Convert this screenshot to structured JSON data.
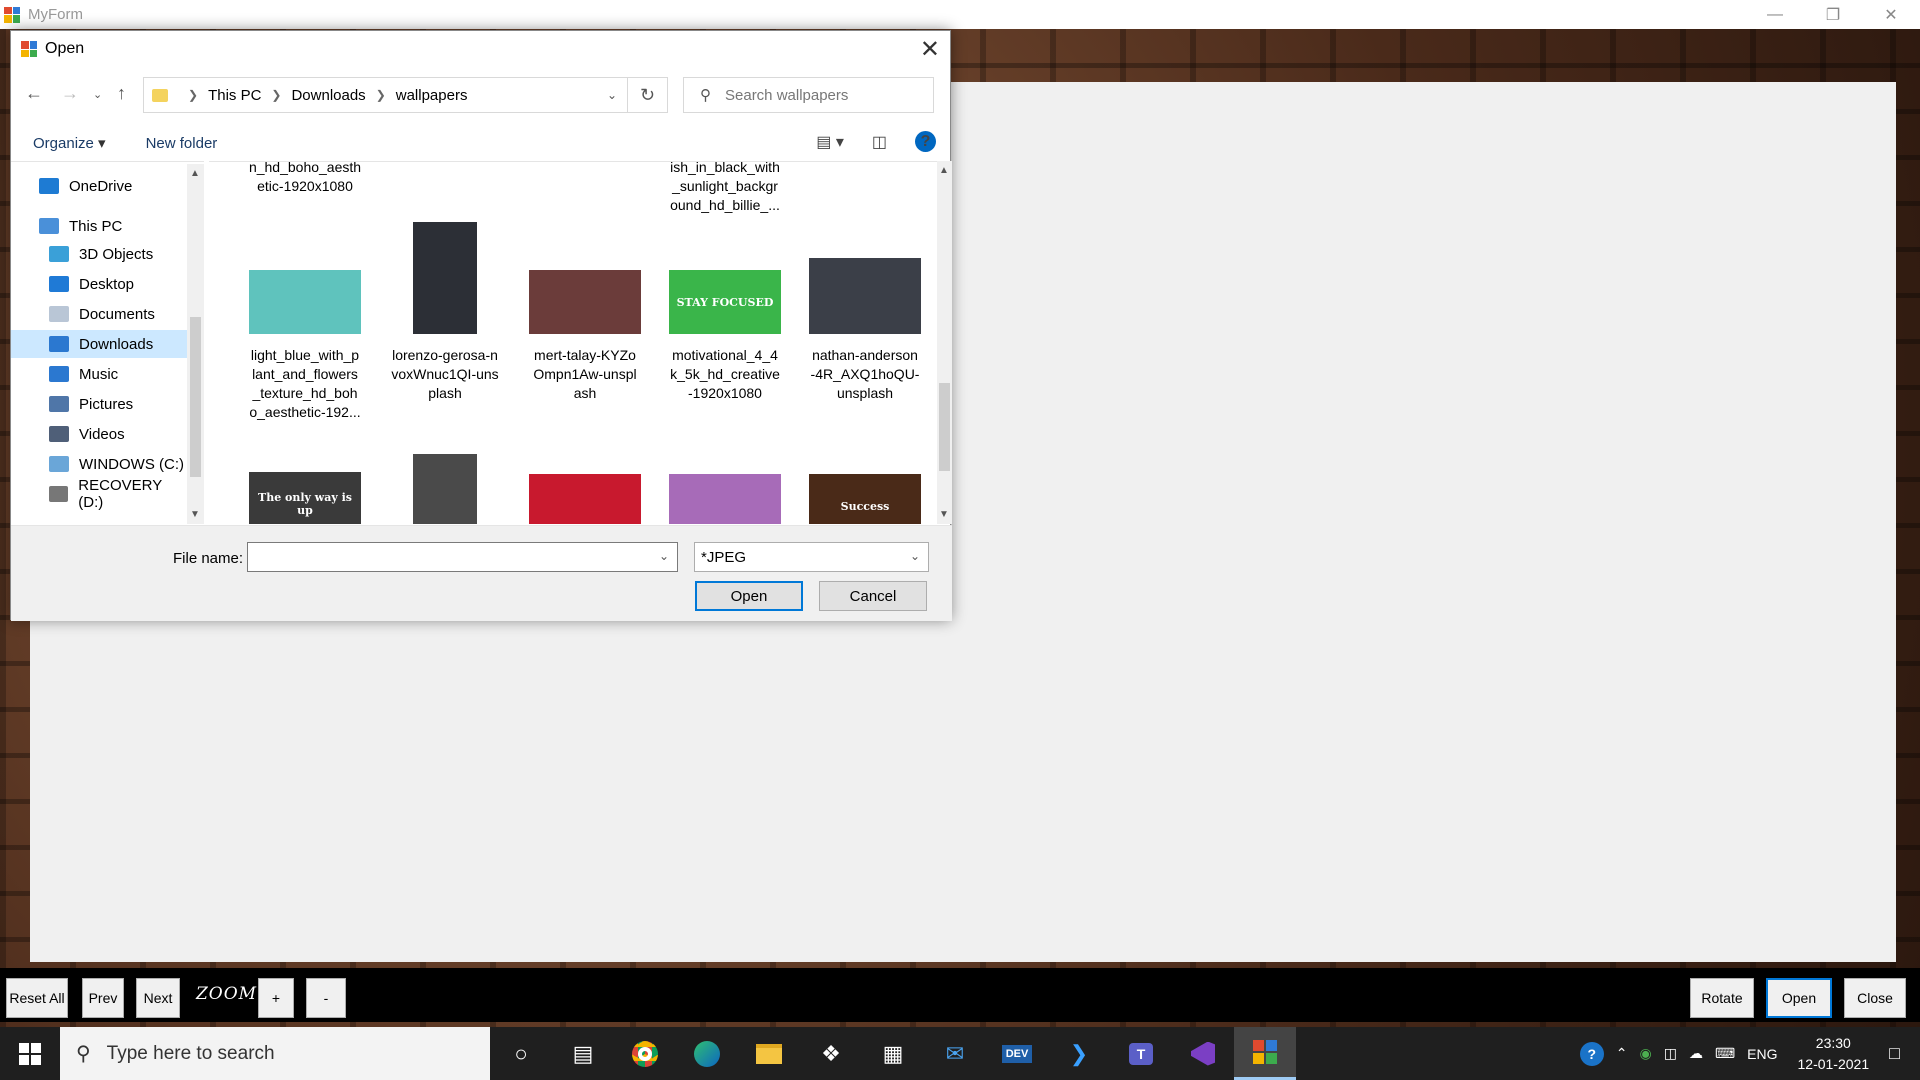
{
  "window": {
    "title": "MyForm",
    "minimize_glyph": "—",
    "maximize_glyph": "❐",
    "close_glyph": "✕"
  },
  "toolbar": {
    "reset_label": "Reset All",
    "prev_label": "Prev",
    "next_label": "Next",
    "zoom_label": "ZOOM",
    "zoom_in_label": "+",
    "zoom_out_label": "-",
    "rotate_label": "Rotate",
    "open_label": "Open",
    "close_label": "Close"
  },
  "dialog": {
    "title": "Open",
    "close_glyph": "✕",
    "breadcrumb": [
      "This PC",
      "Downloads",
      "wallpapers"
    ],
    "search_placeholder": "Search wallpapers",
    "organize_label": "Organize",
    "new_folder_label": "New folder",
    "help_glyph": "?",
    "nav_items": [
      {
        "label": "OneDrive",
        "icon": "cloud-icon",
        "color": "#1e7bd3"
      },
      {
        "label": "This PC",
        "icon": "computer-icon",
        "color": "#4a90d9"
      },
      {
        "label": "3D Objects",
        "icon": "cube-icon",
        "color": "#3aa0d8"
      },
      {
        "label": "Desktop",
        "icon": "desktop-icon",
        "color": "#1f7ad6"
      },
      {
        "label": "Documents",
        "icon": "document-icon",
        "color": "#b9c6d6"
      },
      {
        "label": "Downloads",
        "icon": "download-icon",
        "color": "#2b78d0"
      },
      {
        "label": "Music",
        "icon": "music-icon",
        "color": "#2b78d0"
      },
      {
        "label": "Pictures",
        "icon": "picture-icon",
        "color": "#4f76a8"
      },
      {
        "label": "Videos",
        "icon": "video-icon",
        "color": "#4f5f78"
      },
      {
        "label": "WINDOWS (C:)",
        "icon": "drive-c-icon",
        "color": "#6aa6d8"
      },
      {
        "label": "RECOVERY (D:)",
        "icon": "drive-d-icon",
        "color": "#777777"
      }
    ],
    "files": [
      {
        "name": "n_hd_boho_aesth etic-1920x1080",
        "color": "#7ab"
      },
      {
        "name": "ish_in_black_with _sunlight_backgr ound_hd_billie_...",
        "color": "#333"
      },
      {
        "name": "light_blue_with_p lant_and_flowers _texture_hd_boh o_aesthetic-192...",
        "color": "#5fc3bd"
      },
      {
        "name": "lorenzo-gerosa-n voxWnuc1QI-uns plash",
        "color": "#2c2f36"
      },
      {
        "name": "mert-talay-KYZo Ompn1Aw-unspl ash",
        "color": "#6b3c3a"
      },
      {
        "name": "motivational_4_4 k_5k_hd_creative -1920x1080",
        "color": "#3ab54a",
        "caption": "STAY FOCUSED"
      },
      {
        "name": "nathan-anderson -4R_AXQ1hoQU- unsplash",
        "color": "#3b3f48"
      },
      {
        "name": "",
        "color": "#3a3a3a",
        "caption": "The only way is up"
      },
      {
        "name": "",
        "color": "#4a4a4a"
      },
      {
        "name": "",
        "color": "#c8192e"
      },
      {
        "name": "",
        "color": "#a76bb8"
      },
      {
        "name": "",
        "color": "#4a2a18",
        "caption": "Success"
      }
    ],
    "file_name_label": "File name:",
    "file_name_value": "",
    "file_type_value": "*JPEG",
    "open_button": "Open",
    "cancel_button": "Cancel"
  },
  "taskbar": {
    "search_placeholder": "Type here to search",
    "language": "ENG",
    "time": "23:30",
    "date": "12-01-2021",
    "apps": [
      "cortana-icon",
      "task-view-icon",
      "chrome-icon",
      "edge-icon",
      "file-explorer-icon",
      "dropbox-icon",
      "store-icon",
      "mail-icon",
      "devexpress-icon",
      "azure-icon",
      "teams-icon",
      "visual-studio-icon",
      "myform-app-icon"
    ]
  }
}
